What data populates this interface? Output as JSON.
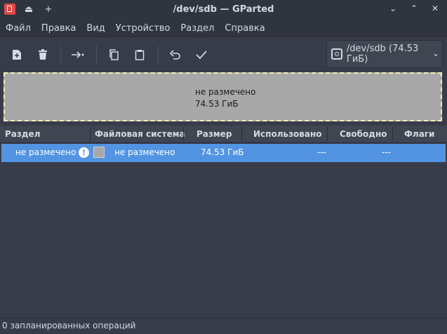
{
  "window": {
    "title": "/dev/sdb — GParted",
    "icons": [
      "gparted-app-icon",
      "eject-icon",
      "plus-icon",
      "minimize-icon",
      "maximize-icon",
      "close-icon"
    ]
  },
  "menu": [
    "Файл",
    "Правка",
    "Вид",
    "Устройство",
    "Раздел",
    "Справка"
  ],
  "toolbar": {
    "icons": [
      "new-partition-icon",
      "delete-icon",
      "resize-move-icon",
      "copy-icon",
      "paste-icon",
      "undo-icon",
      "apply-icon"
    ],
    "device": "/dev/sdb   (74.53 ГиБ)"
  },
  "disk_graphic": {
    "line1": "не размечено",
    "line2": "74.53 ГиБ",
    "fill_color": "#a8a8a8",
    "border_color": "#f6efb8"
  },
  "table": {
    "headers": [
      "Раздел",
      "Файловая система",
      "Размер",
      "Использовано",
      "Свободно",
      "Флаги"
    ],
    "rows": [
      {
        "partition": "не размечено",
        "filesystem": "не размечено",
        "size": "74.53 ГиБ",
        "used": "---",
        "free": "---",
        "flags": ""
      }
    ],
    "selection_color": "#5294e2"
  },
  "status": "0 запланированных операций"
}
